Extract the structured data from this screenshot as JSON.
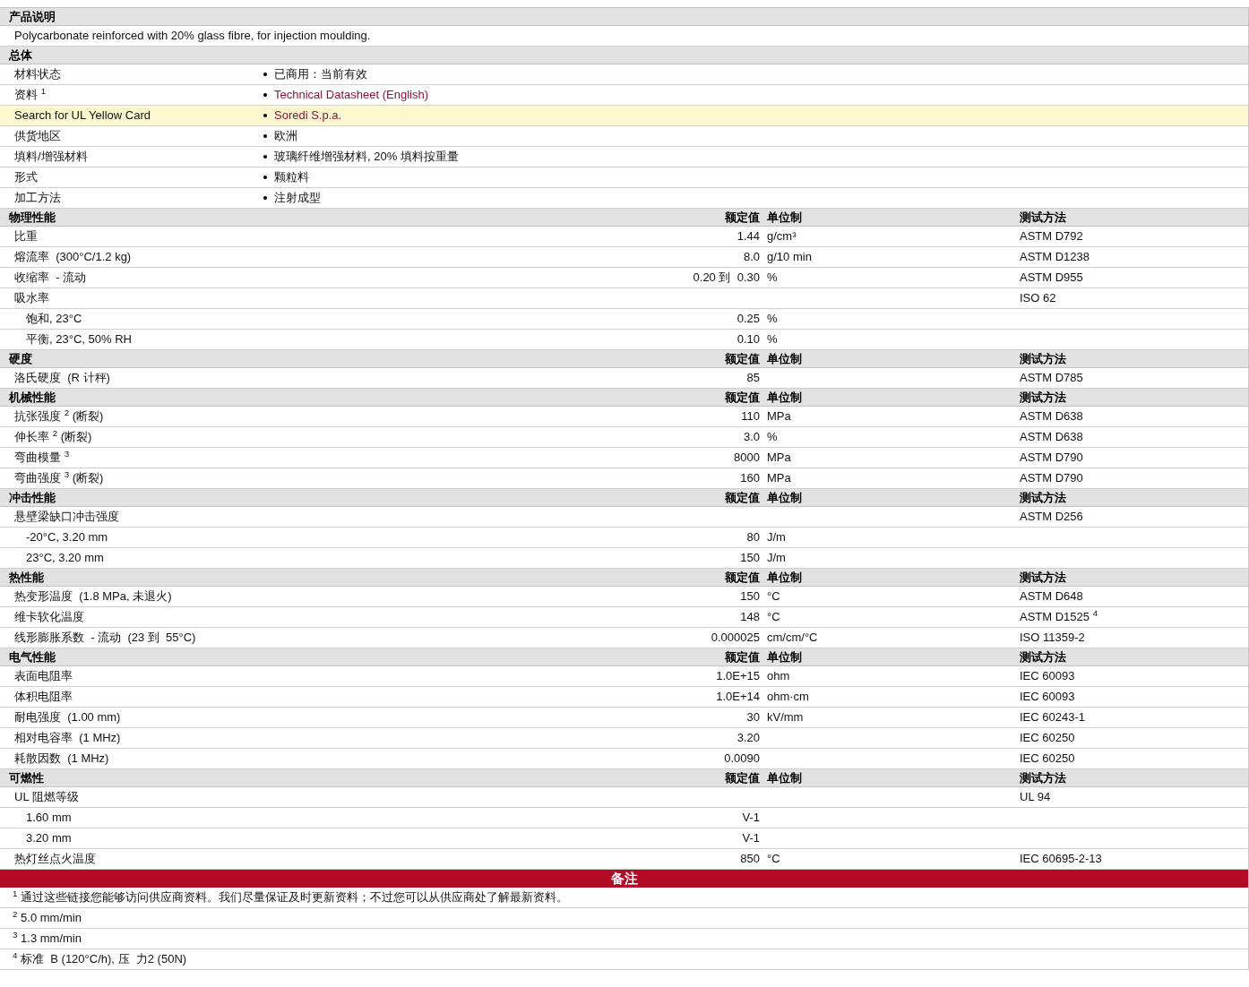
{
  "description": {
    "header": "产品说明",
    "text": "Polycarbonate reinforced with 20% glass fibre, for injection moulding."
  },
  "general": {
    "header": "总体",
    "rows": [
      {
        "label": "材料状态",
        "value": "已商用：当前有效",
        "kind": "text",
        "highlighted": false
      },
      {
        "label": "资料 $^{1}$",
        "value": "Technical Datasheet (English)",
        "kind": "link",
        "highlighted": false
      },
      {
        "label": "Search for UL Yellow Card",
        "value": "Soredi S.p.a.",
        "kind": "link",
        "highlighted": true
      },
      {
        "label": "供货地区",
        "value": "欧洲",
        "kind": "text",
        "highlighted": false
      },
      {
        "label": "填料/增强材料",
        "value": "玻璃纤维增强材料, 20% 填料按重量",
        "kind": "text",
        "highlighted": false
      },
      {
        "label": "形式",
        "value": "颗粒料",
        "kind": "text",
        "highlighted": false
      },
      {
        "label": "加工方法",
        "value": "注射成型",
        "kind": "text",
        "highlighted": false
      }
    ]
  },
  "sections": [
    {
      "header": "物理性能",
      "columns": [
        "额定值",
        "单位制",
        "测试方法"
      ],
      "rows": [
        {
          "label": "比重",
          "value": "1.44",
          "unit": "g/cm³",
          "method": "ASTM D792"
        },
        {
          "label": "熔流率  (300°C/1.2 kg)",
          "value": "8.0",
          "unit": "g/10 min",
          "method": "ASTM D1238"
        },
        {
          "label": "收缩率  - 流动",
          "value": "0.20 到  0.30",
          "unit": "%",
          "method": "ASTM D955"
        },
        {
          "label": "吸水率",
          "method": "ISO 62",
          "children": [
            {
              "label": "饱和, 23°C",
              "value": "0.25",
              "unit": "%"
            },
            {
              "label": "平衡, 23°C, 50% RH",
              "value": "0.10",
              "unit": "%"
            }
          ]
        }
      ]
    },
    {
      "header": "硬度",
      "columns": [
        "额定值",
        "单位制",
        "测试方法"
      ],
      "rows": [
        {
          "label": "洛氏硬度  (R 计秤)",
          "value": "85",
          "method": "ASTM D785"
        }
      ]
    },
    {
      "header": "机械性能",
      "columns": [
        "额定值",
        "单位制",
        "测试方法"
      ],
      "rows": [
        {
          "label": "抗张强度 $^{2}$ (断裂)",
          "value": "110",
          "unit": "MPa",
          "method": "ASTM D638"
        },
        {
          "label": "伸长率 $^{2}$ (断裂)",
          "value": "3.0",
          "unit": "%",
          "method": "ASTM D638"
        },
        {
          "label": "弯曲模量 $^{3}$",
          "value": "8000",
          "unit": "MPa",
          "method": "ASTM D790"
        },
        {
          "label": "弯曲强度 $^{3}$ (断裂)",
          "value": "160",
          "unit": "MPa",
          "method": "ASTM D790"
        }
      ]
    },
    {
      "header": "冲击性能",
      "columns": [
        "额定值",
        "单位制",
        "测试方法"
      ],
      "rows": [
        {
          "label": "悬壁梁缺口冲击强度",
          "method": "ASTM D256",
          "children": [
            {
              "label": "-20°C, 3.20 mm",
              "value": "80",
              "unit": "J/m"
            },
            {
              "label": "23°C, 3.20 mm",
              "value": "150",
              "unit": "J/m"
            }
          ]
        }
      ]
    },
    {
      "header": "热性能",
      "columns": [
        "额定值",
        "单位制",
        "测试方法"
      ],
      "rows": [
        {
          "label": "热变形温度  (1.8 MPa, 未退火)",
          "value": "150",
          "unit": "°C",
          "method": "ASTM D648"
        },
        {
          "label": "维卡软化温度",
          "value": "148",
          "unit": "°C",
          "method": "ASTM D1525 $^{4}$"
        },
        {
          "label": "线形膨胀系数  - 流动  (23 到  55°C)",
          "value": "0.000025",
          "unit": "cm/cm/°C",
          "method": "ISO 11359-2"
        }
      ]
    },
    {
      "header": "电气性能",
      "columns": [
        "额定值",
        "单位制",
        "测试方法"
      ],
      "rows": [
        {
          "label": "表面电阻率",
          "value": "1.0E+15",
          "unit": "ohm",
          "method": "IEC 60093"
        },
        {
          "label": "体积电阻率",
          "value": "1.0E+14",
          "unit": "ohm·cm",
          "method": "IEC 60093"
        },
        {
          "label": "耐电强度  (1.00 mm)",
          "value": "30",
          "unit": "kV/mm",
          "method": "IEC 60243-1"
        },
        {
          "label": "相对电容率  (1 MHz)",
          "value": "3.20",
          "method": "IEC 60250"
        },
        {
          "label": "耗散因数  (1 MHz)",
          "value": "0.0090",
          "method": "IEC 60250"
        }
      ]
    },
    {
      "header": "可燃性",
      "columns": [
        "额定值",
        "单位制",
        "测试方法"
      ],
      "rows": [
        {
          "label": "UL 阻燃等级",
          "method": "UL 94",
          "children": [
            {
              "label": "1.60 mm",
              "value": "V-1"
            },
            {
              "label": "3.20 mm",
              "value": "V-1"
            }
          ]
        },
        {
          "label": "热灯丝点火温度",
          "value": "850",
          "unit": "°C",
          "method": "IEC 60695-2-13"
        }
      ]
    }
  ],
  "notes": {
    "header": "备注",
    "items": [
      "$^{1}$ 通过这些链接您能够访问供应商资料。我们尽量保证及时更新资料；不过您可以从供应商处了解最新资料。",
      "$^{2}$ 5.0 mm/min",
      "$^{3}$ 1.3 mm/min",
      "$^{4}$ 标准  B (120°C/h), 压  力2 (50N)"
    ]
  }
}
